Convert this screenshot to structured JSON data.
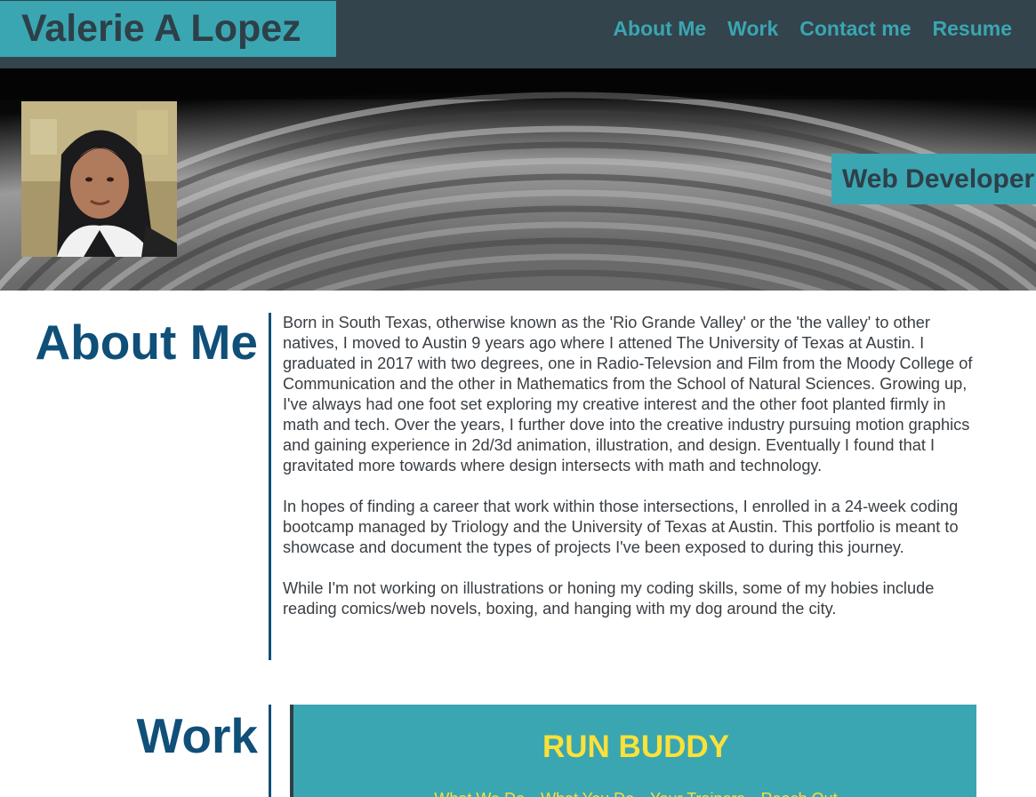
{
  "header": {
    "brand": "Valerie A Lopez",
    "nav": [
      "About Me",
      "Work",
      "Contact me",
      "Resume"
    ]
  },
  "hero": {
    "role": "Web Developer"
  },
  "about": {
    "title": "About Me",
    "paragraphs": [
      "Born in South Texas, otherwise known as the 'Rio Grande Valley' or the 'the valley' to other natives, I moved to Austin 9 years ago where I attened The University of Texas at Austin. I graduated in 2017 with two degrees, one in Radio-Televsion and Film from the Moody College of Communication and the other in Mathematics from the School of Natural Sciences. Growing up, I've always had one foot set exploring my creative interest and the other foot planted firmly in math and tech. Over the years, I further dove into the creative industry pursuing motion graphics and gaining experience in 2d/3d animation, illustration, and design. Eventually I found that I gravitated more towards where design intersects with math and technology.",
      "In hopes of finding a career that work within those intersections, I enrolled in a 24-week coding bootcamp managed by Triology and the University of Texas at Austin. This portfolio is meant to showcase and document the types of projects I've been exposed to during this journey.",
      "While I'm not working on illustrations or honing my coding skills, some of my hobies include reading comics/web novels, boxing, and hanging with my dog around the city."
    ]
  },
  "work": {
    "title": "Work",
    "project": {
      "title": "RUN BUDDY",
      "nav": [
        "What We Do",
        "What You Do",
        "Your Trainers",
        "Reach Out"
      ]
    }
  },
  "colors": {
    "header_bg": "#33444c",
    "accent_teal": "#3aa6b2",
    "heading_blue": "#0f4f78",
    "project_yellow": "#fce138"
  }
}
